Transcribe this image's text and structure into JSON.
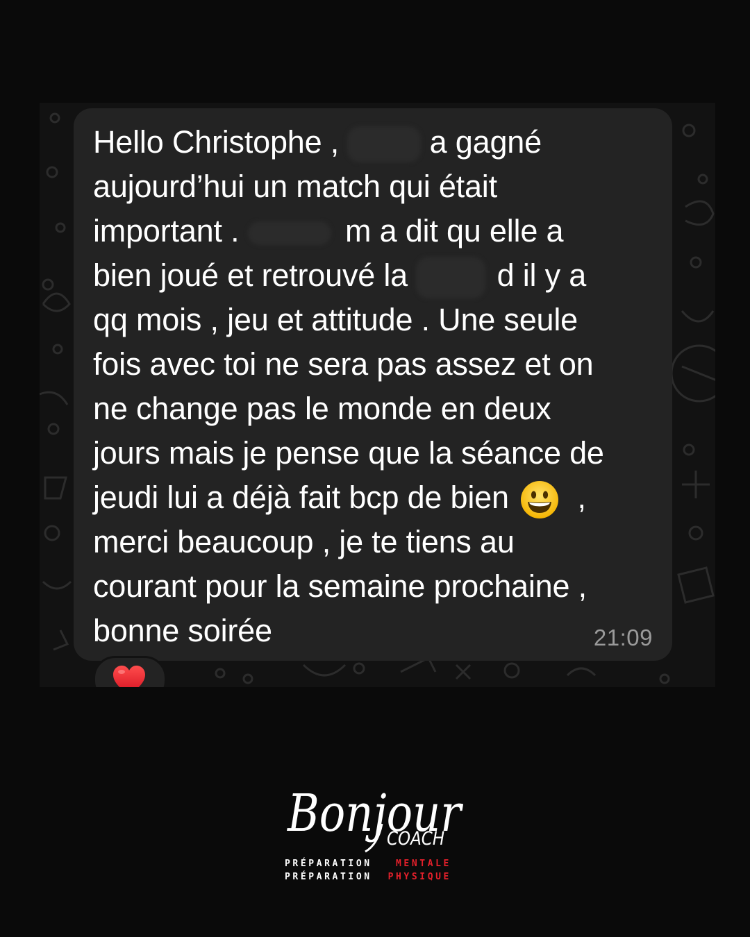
{
  "message": {
    "lines": [
      [
        "Hello Christophe , ",
        " a gagné"
      ],
      [
        "aujourd’hui un match qui était"
      ],
      [
        "important . ",
        " m a dit qu elle a"
      ],
      [
        "bien joué et retrouvé la ",
        " d il y a"
      ],
      [
        "qq mois , jeu et attitude . Une seule"
      ],
      [
        "fois avec toi ne sera pas assez et on"
      ],
      [
        "ne change pas le monde en deux"
      ],
      [
        "jours mais je pense que la séance de"
      ],
      [
        "jeudi lui a déjà fait bcp de bien ",
        " ,"
      ],
      [
        "merci beaucoup , je te tiens au"
      ],
      [
        "courant pour la semaine prochaine ,"
      ],
      [
        "bonne soirée"
      ]
    ],
    "timestamp": "21:09",
    "inline_emoji": "grinning-face-icon",
    "reaction": "heart-icon"
  },
  "branding": {
    "script": "Bonjour",
    "coach": "COACH",
    "tagline": [
      {
        "prefix": "PRÉPARATION",
        "accent": "MENTALE"
      },
      {
        "prefix": "PRÉPARATION",
        "accent": "PHYSIQUE"
      }
    ],
    "accent_color": "#e4202b"
  },
  "colors": {
    "background": "#0a0a0a",
    "chat_background": "#121212",
    "bubble": "#232323",
    "text": "#ffffff",
    "timestamp": "#9a9a9a"
  }
}
